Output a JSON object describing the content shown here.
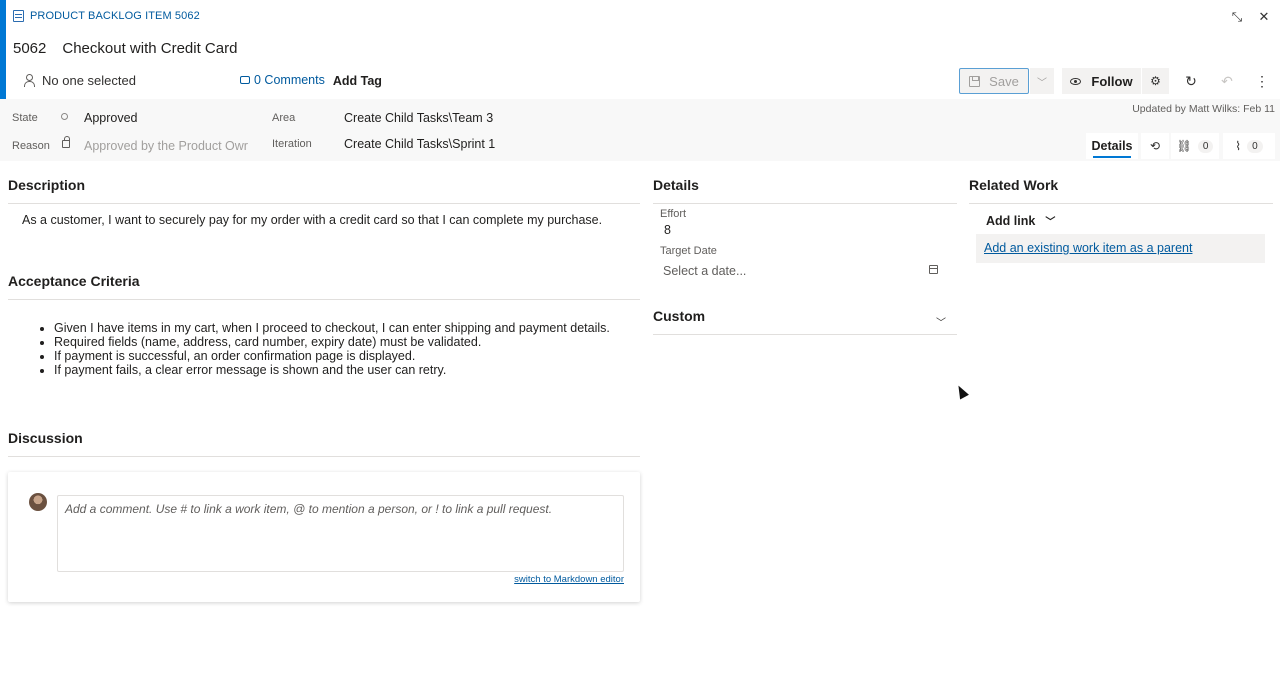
{
  "header": {
    "type_label": "PRODUCT BACKLOG ITEM 5062",
    "id": "5062",
    "title": "Checkout with Credit Card",
    "assigned": "No one selected",
    "comments": "0 Comments",
    "add_tag": "Add Tag",
    "updated": "Updated by Matt Wilks: Feb 11"
  },
  "toolbar": {
    "save_label": "Save",
    "follow_label": "Follow"
  },
  "fields": {
    "state_label": "State",
    "state_value": "Approved",
    "reason_label": "Reason",
    "reason_value": "Approved by the Product Owr",
    "area_label": "Area",
    "area_value": "Create Child Tasks\\Team 3",
    "iteration_label": "Iteration",
    "iteration_value": "Create Child Tasks\\Sprint 1"
  },
  "tabs": {
    "details": "Details",
    "links_count": "0",
    "attachments_count": "0"
  },
  "description": {
    "title": "Description",
    "text": "As a customer, I want to securely pay for my order with a credit card so that I can complete my purchase."
  },
  "acceptance": {
    "title": "Acceptance Criteria",
    "items": [
      "Given I have items in my cart, when I proceed to checkout, I can enter shipping and payment details.",
      "Required fields (name, address, card number, expiry date) must be validated.",
      "If payment is successful, an order confirmation page is displayed.",
      "If payment fails, a clear error message is shown and the user can retry."
    ]
  },
  "discussion": {
    "title": "Discussion",
    "placeholder": "Add a comment. Use # to link a work item, @ to mention a person, or ! to link a pull request.",
    "markdown_link": "switch to Markdown editor"
  },
  "details": {
    "title": "Details",
    "effort_label": "Effort",
    "effort_value": "8",
    "target_date_label": "Target Date",
    "target_date_placeholder": "Select a date...",
    "custom_title": "Custom"
  },
  "related": {
    "title": "Related Work",
    "add_link": "Add link",
    "parent_link": "Add an existing work item as a parent"
  }
}
